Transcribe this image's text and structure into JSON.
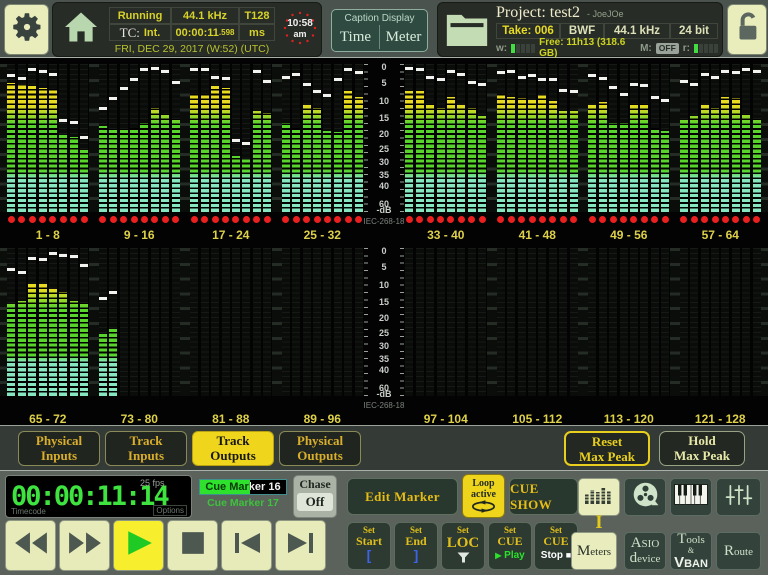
{
  "header": {
    "status": {
      "state": "Running",
      "sample_rate": "44.1 kHz",
      "tracks": "T128",
      "tc_label": "TC:",
      "tc_source": "Int.",
      "tc_value": "00:00:11",
      "tc_frac": ".598",
      "tc_unit": "ms",
      "date": "FRI, DEC 29, 2017 (W:52) (UTC)"
    },
    "clock": {
      "time": "10:58",
      "ampm": "am"
    },
    "caption": {
      "title": "Caption Display",
      "time": "Time",
      "meter": "Meter"
    },
    "project": {
      "label": "Project:",
      "name": "test2",
      "owner": "- JoeJOe",
      "take": "Take: 006",
      "format": "BWF",
      "rate": "44.1 kHz",
      "depth": "24 bit",
      "w_label": "w:",
      "w_lit": 1,
      "w_total": 5,
      "free": "Free: 11h13 (318.6 GB)",
      "m_label": "M:",
      "m_value": "OFF",
      "r_label": "r:",
      "r_lit": 1,
      "r_total": 5
    }
  },
  "meters": {
    "scale_labels": [
      "0",
      "5",
      "10",
      "15",
      "20",
      "25",
      "30",
      "35",
      "40",
      "60",
      "-dB"
    ],
    "standard": "IEC-268-18",
    "rows": [
      {
        "banks": [
          {
            "label": "1 - 8",
            "dots": true,
            "levels": [
              0.87,
              0.86,
              0.85,
              0.84,
              0.83,
              0.52,
              0.51,
              0.42
            ],
            "peaks": [
              0.93,
              0.91,
              0.97,
              0.96,
              0.94,
              0.62,
              0.61,
              0.5
            ]
          },
          {
            "label": "9 - 16",
            "dots": true,
            "levels": [
              0.58,
              0.56,
              0.56,
              0.57,
              0.6,
              0.7,
              0.66,
              0.63
            ],
            "peaks": [
              0.7,
              0.77,
              0.84,
              0.9,
              0.97,
              0.98,
              0.96,
              0.88
            ]
          },
          {
            "label": "17 - 24",
            "dots": true,
            "levels": [
              0.8,
              0.8,
              0.85,
              0.84,
              0.38,
              0.36,
              0.68,
              0.67
            ],
            "peaks": [
              0.97,
              0.97,
              0.92,
              0.91,
              0.48,
              0.46,
              0.96,
              0.89
            ]
          },
          {
            "label": "25 - 32",
            "dots": true,
            "levels": [
              0.6,
              0.57,
              0.72,
              0.7,
              0.55,
              0.54,
              0.82,
              0.78
            ],
            "peaks": [
              0.92,
              0.94,
              0.87,
              0.82,
              0.79,
              0.9,
              0.97,
              0.95
            ]
          },
          {
            "label": "33 - 40",
            "dots": true,
            "levels": [
              0.82,
              0.82,
              0.73,
              0.7,
              0.78,
              0.72,
              0.7,
              0.65
            ],
            "peaks": [
              0.98,
              0.97,
              0.92,
              0.9,
              0.96,
              0.94,
              0.88,
              0.87
            ]
          },
          {
            "label": "41 - 48",
            "dots": true,
            "levels": [
              0.8,
              0.78,
              0.77,
              0.76,
              0.79,
              0.75,
              0.68,
              0.68
            ],
            "peaks": [
              0.95,
              0.96,
              0.92,
              0.93,
              0.9,
              0.9,
              0.83,
              0.82
            ]
          },
          {
            "label": "49 - 56",
            "dots": true,
            "levels": [
              0.72,
              0.74,
              0.6,
              0.6,
              0.73,
              0.73,
              0.57,
              0.55
            ],
            "peaks": [
              0.93,
              0.91,
              0.85,
              0.8,
              0.87,
              0.86,
              0.78,
              0.76
            ]
          },
          {
            "label": "57 - 64",
            "dots": true,
            "levels": [
              0.62,
              0.65,
              0.72,
              0.7,
              0.78,
              0.77,
              0.66,
              0.63
            ],
            "peaks": [
              0.89,
              0.87,
              0.94,
              0.92,
              0.96,
              0.95,
              0.97,
              0.96
            ]
          }
        ]
      },
      {
        "banks": [
          {
            "label": "65 - 72",
            "dots": false,
            "levels": [
              0.62,
              0.64,
              0.76,
              0.76,
              0.72,
              0.7,
              0.64,
              0.63
            ],
            "peaks": [
              0.86,
              0.84,
              0.94,
              0.93,
              0.97,
              0.96,
              0.95,
              0.89
            ]
          },
          {
            "label": "73 - 80",
            "dots": false,
            "levels": [
              0.42,
              0.45,
              0,
              0,
              0,
              0,
              0,
              0
            ],
            "peaks": [
              0.66,
              0.7,
              0,
              0,
              0,
              0,
              0,
              0
            ]
          },
          {
            "label": "81 - 88",
            "dots": false,
            "levels": [
              0,
              0,
              0,
              0,
              0,
              0,
              0,
              0
            ],
            "peaks": [
              0,
              0,
              0,
              0,
              0,
              0,
              0,
              0
            ]
          },
          {
            "label": "89 - 96",
            "dots": false,
            "levels": [
              0,
              0,
              0,
              0,
              0,
              0,
              0,
              0
            ],
            "peaks": [
              0,
              0,
              0,
              0,
              0,
              0,
              0,
              0
            ]
          },
          {
            "label": "97 - 104",
            "dots": false,
            "levels": [
              0,
              0,
              0,
              0,
              0,
              0,
              0,
              0
            ],
            "peaks": [
              0,
              0,
              0,
              0,
              0,
              0,
              0,
              0
            ]
          },
          {
            "label": "105 - 112",
            "dots": false,
            "levels": [
              0,
              0,
              0,
              0,
              0,
              0,
              0,
              0
            ],
            "peaks": [
              0,
              0,
              0,
              0,
              0,
              0,
              0,
              0
            ]
          },
          {
            "label": "113 - 120",
            "dots": false,
            "levels": [
              0,
              0,
              0,
              0,
              0,
              0,
              0,
              0
            ],
            "peaks": [
              0,
              0,
              0,
              0,
              0,
              0,
              0,
              0
            ]
          },
          {
            "label": "121 - 128",
            "dots": false,
            "levels": [
              0,
              0,
              0,
              0,
              0,
              0,
              0,
              0
            ],
            "peaks": [
              0,
              0,
              0,
              0,
              0,
              0,
              0,
              0
            ]
          }
        ]
      }
    ]
  },
  "view_buttons": [
    {
      "line1": "Physical",
      "line2": "Inputs",
      "active": false
    },
    {
      "line1": "Track",
      "line2": "Inputs",
      "active": false
    },
    {
      "line1": "Track",
      "line2": "Outputs",
      "active": true
    },
    {
      "line1": "Physical",
      "line2": "Outputs",
      "active": false
    }
  ],
  "peak_buttons": [
    {
      "line1": "Reset",
      "line2": "Max Peak"
    },
    {
      "line1": "Hold",
      "line2": "Max Peak"
    }
  ],
  "transport": {
    "tc_display": "00:00:11:14",
    "fps": "25 fps",
    "tc_caption": "Timecode",
    "options_caption": "Options",
    "cue_current": "Cue Marker 16",
    "cue_next": "Cue Marker 17",
    "cue_progress": 0.58,
    "chase_label": "Chase",
    "chase_value": "Off"
  },
  "marker_controls": {
    "edit": "Edit Marker",
    "loop_line1": "Loop",
    "loop_line2": "active",
    "cue_show": "CUE SHOW"
  },
  "set_buttons": [
    {
      "top": "Set",
      "mid": "Start",
      "tag": "[",
      "kind": "bracket"
    },
    {
      "top": "Set",
      "mid": "End",
      "tag": "]",
      "kind": "bracket"
    },
    {
      "top": "Set",
      "mid": "LOC",
      "tag": "",
      "kind": "funnel"
    },
    {
      "top": "Set",
      "mid": "CUE",
      "tag": "Play",
      "kind": "play"
    },
    {
      "top": "Set",
      "mid": "CUE",
      "tag": "Stop",
      "kind": "stop"
    }
  ],
  "right_panel": {
    "buttons": [
      {
        "lines": [
          "Meters"
        ],
        "active": true
      },
      {
        "lines": [
          "ASIO",
          "device"
        ],
        "active": false
      },
      {
        "lines": [
          "Tools",
          "&",
          "VBAN"
        ],
        "active": false
      },
      {
        "lines": [
          "Route"
        ],
        "active": false
      }
    ]
  },
  "colors": {
    "accent_yellow": "#efd51c",
    "meter_green": "#57d32c",
    "meter_yellow": "#e8da20",
    "meter_aqua": "#85e6c0",
    "peak_white": "#f2f2ee",
    "signal_red": "#ea1f1f",
    "lcd_green": "#3fe33f"
  }
}
